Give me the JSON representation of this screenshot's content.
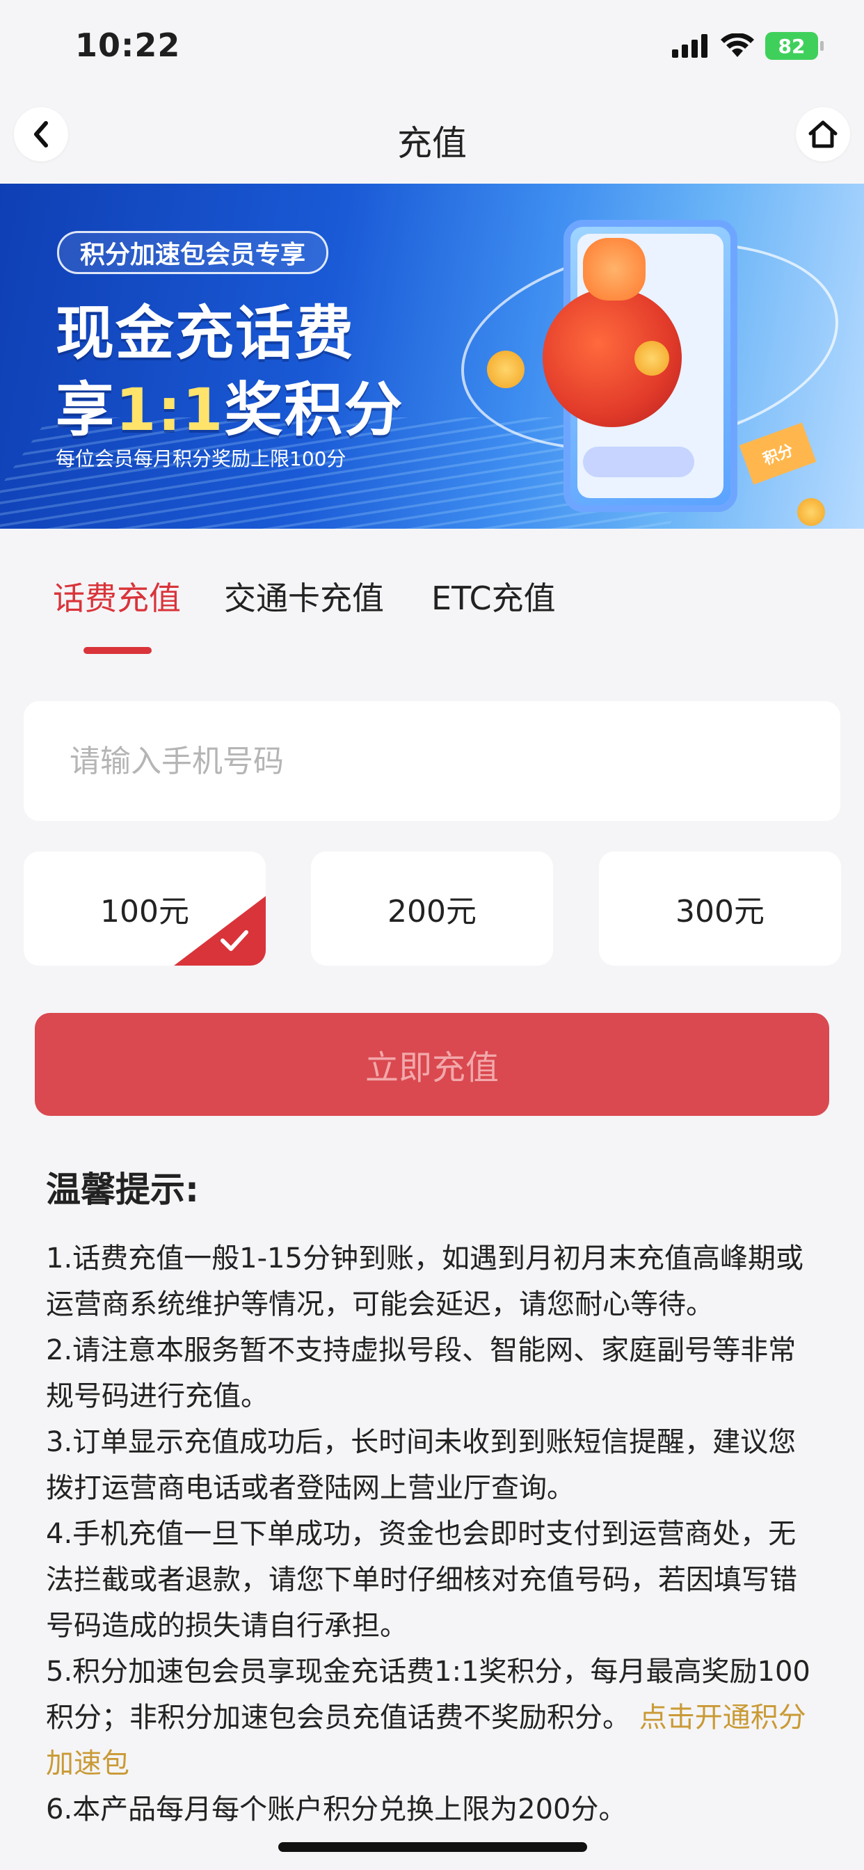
{
  "status_bar": {
    "time": "10:22",
    "battery": "82"
  },
  "nav": {
    "title": "充值"
  },
  "banner": {
    "badge": "积分加速包会员专享",
    "headline_line1": "现金充话费",
    "headline_line2_prefix": "享",
    "headline_line2_ratio": "1:1",
    "headline_line2_suffix": "奖积分",
    "note": "每位会员每月积分奖励上限100分",
    "ticket_text": "积分"
  },
  "tabs": [
    {
      "label": "话费充值",
      "active": true
    },
    {
      "label": "交通卡充值",
      "active": false
    },
    {
      "label": "ETC充值",
      "active": false
    }
  ],
  "phone_input": {
    "placeholder": "请输入手机号码",
    "value": ""
  },
  "amounts": [
    {
      "label": "100元",
      "selected": true
    },
    {
      "label": "200元",
      "selected": false
    },
    {
      "label": "300元",
      "selected": false
    }
  ],
  "recharge_button": "立即充值",
  "tips": {
    "title": "温馨提示:",
    "items": [
      "1.话费充值一般1-15分钟到账，如遇到月初月末充值高峰期或运营商系统维护等情况，可能会延迟，请您耐心等待。",
      "2.请注意本服务暂不支持虚拟号段、智能网、家庭副号等非常规号码进行充值。",
      "3.订单显示充值成功后，长时间未收到到账短信提醒，建议您拨打运营商电话或者登陆网上营业厅查询。",
      "4.手机充值一旦下单成功，资金也会即时支付到运营商处，无法拦截或者退款，请您下单时仔细核对充值号码，若因填写错号码造成的损失请自行承担。",
      "5.积分加速包会员享现金充话费1:1奖积分，每月最高奖励100积分；非积分加速包会员充值话费不奖励积分。",
      "6.本产品每月每个账户积分兑换上限为200分。"
    ],
    "item5_link": "点击开通积分加速包"
  },
  "colors": {
    "accent": "#d9343a",
    "button": "#d9494f",
    "link": "#c99a35",
    "background": "#f5f5f7"
  }
}
